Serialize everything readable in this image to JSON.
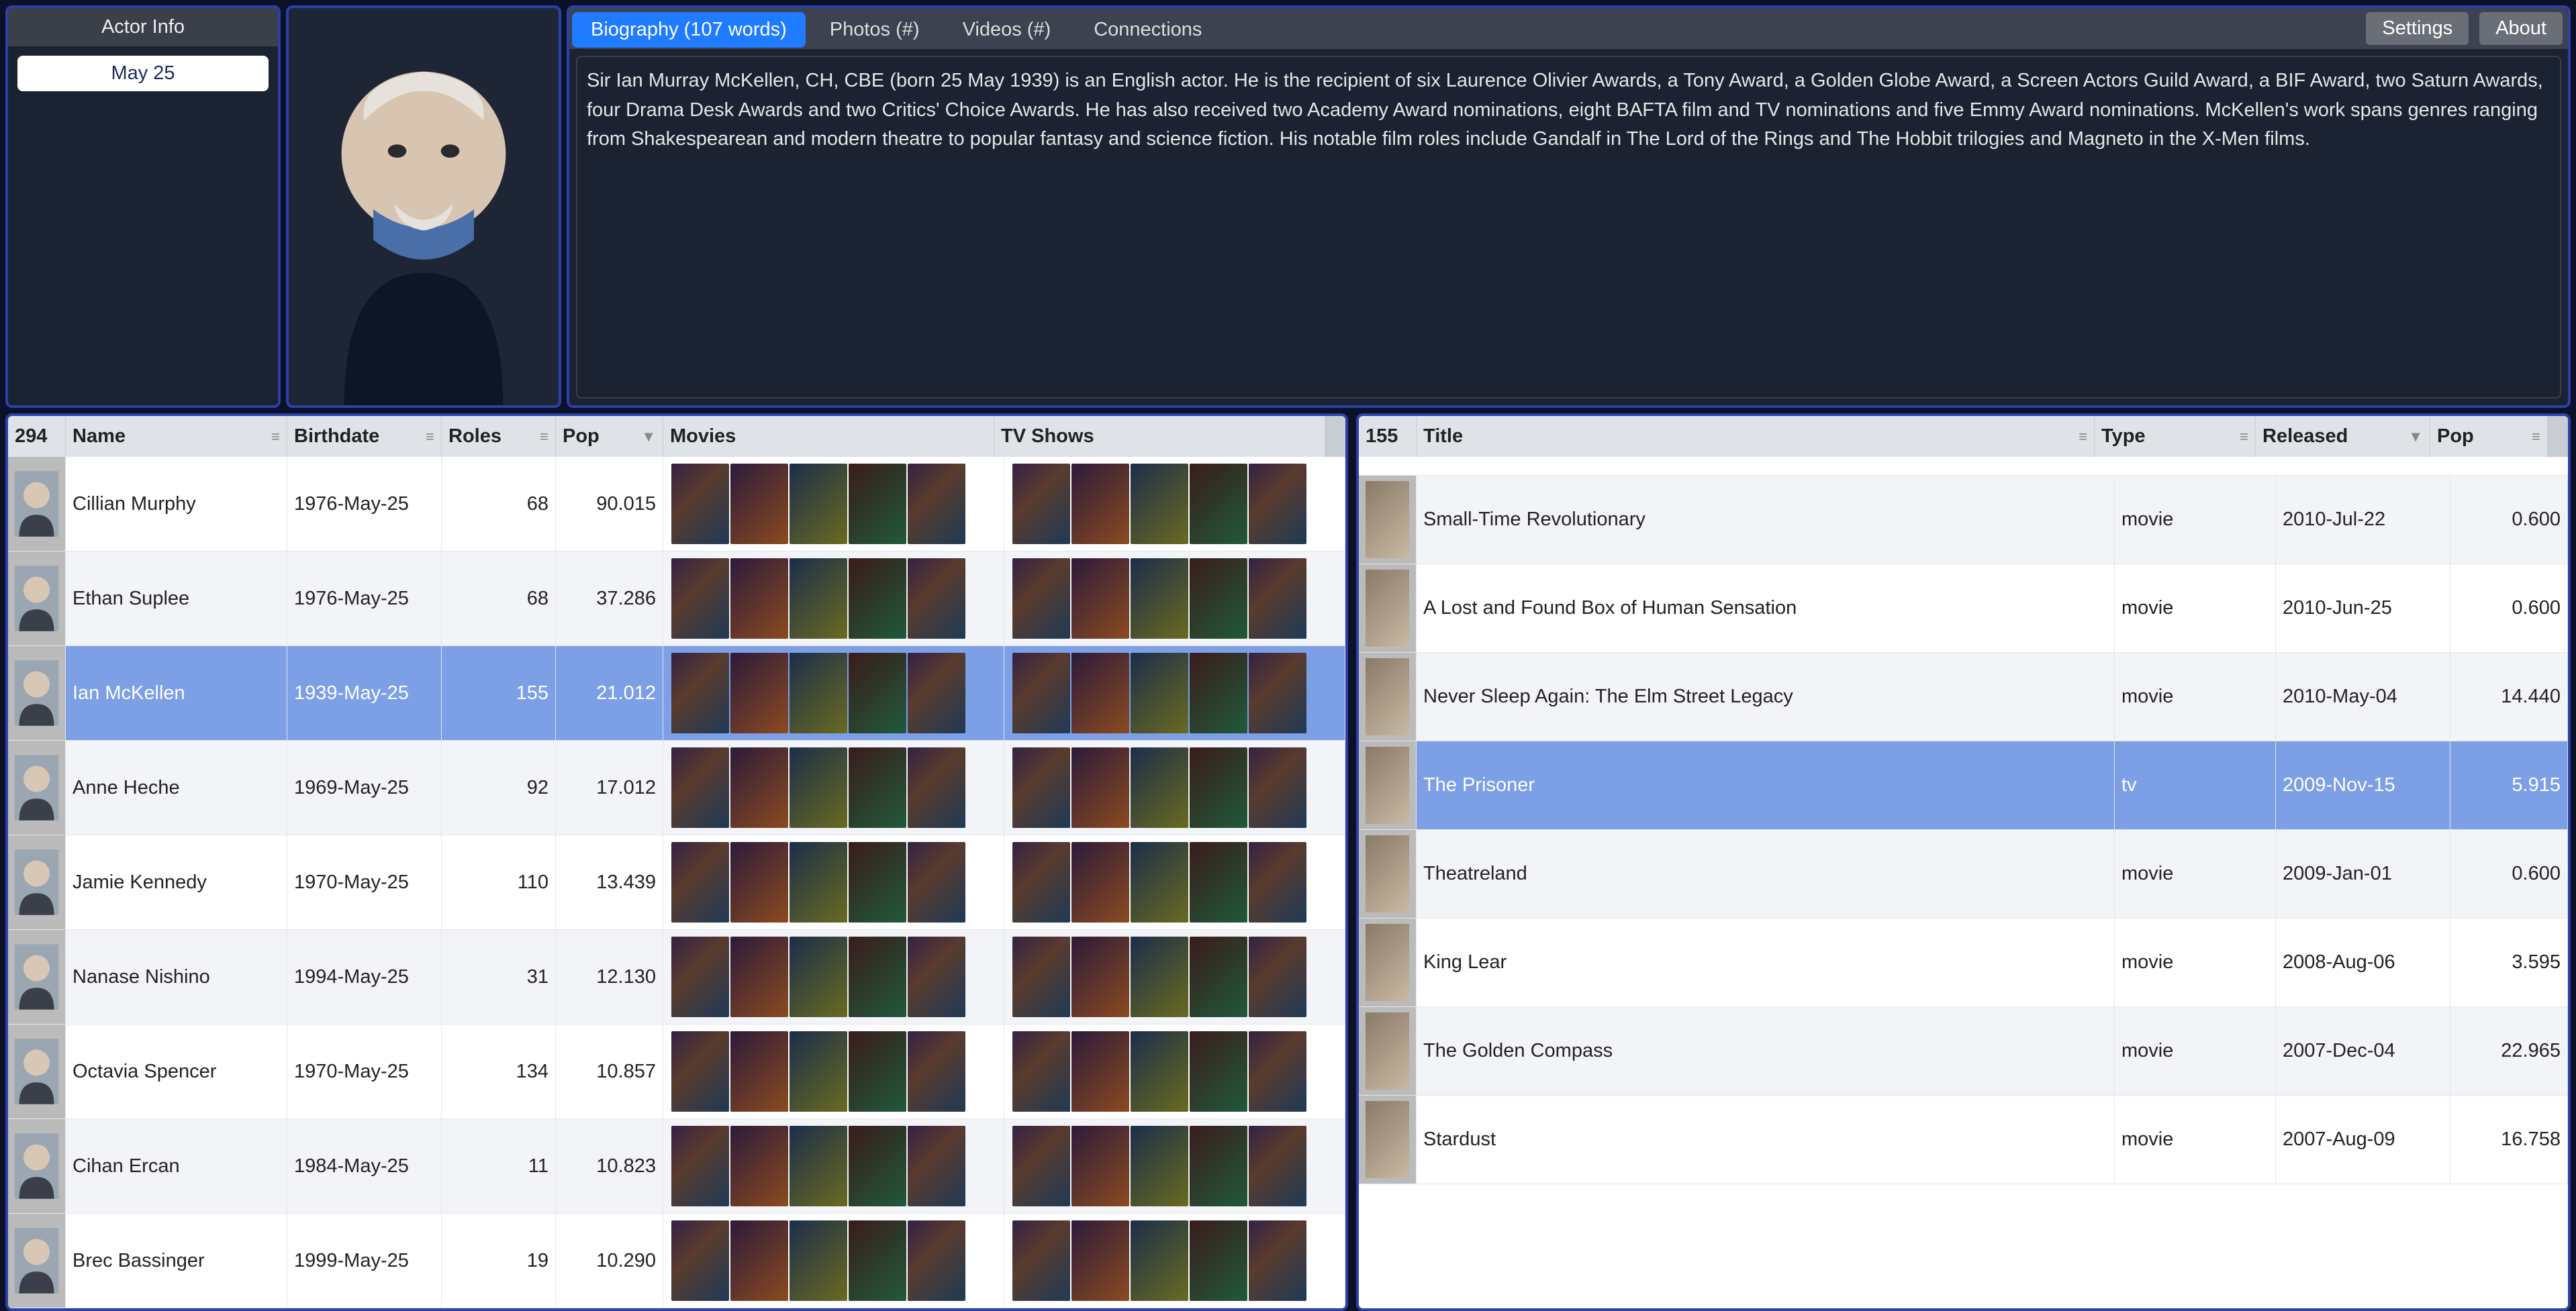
{
  "info": {
    "heading": "Actor Info",
    "chip": "May 25"
  },
  "tabs": {
    "items": [
      {
        "label": "Biography (107 words)",
        "active": true
      },
      {
        "label": "Photos (#)"
      },
      {
        "label": "Videos (#)"
      },
      {
        "label": "Connections"
      }
    ],
    "settings": "Settings",
    "about": "About"
  },
  "biography": "Sir Ian Murray McKellen, CH, CBE (born 25 May 1939) is an English actor. He is the recipient of six Laurence Olivier Awards, a Tony Award, a Golden Globe Award, a Screen Actors Guild Award, a BIF Award, two Saturn Awards, four Drama Desk Awards and two Critics' Choice Awards. He has also received two Academy Award nominations, eight BAFTA film and TV nominations and five Emmy Award nominations. McKellen's work spans genres ranging from Shakespearean and modern theatre to popular fantasy and science fiction. His notable film roles include Gandalf in The Lord of the Rings and The Hobbit trilogies and Magneto in the X-Men films.",
  "actors_table": {
    "count": "294",
    "columns": [
      "Name",
      "Birthdate",
      "Roles",
      "Pop",
      "Movies",
      "TV Shows"
    ],
    "sort_on": "Pop",
    "rows": [
      {
        "name": "Cillian Murphy",
        "birthdate": "1976-May-25",
        "roles": "68",
        "pop": "90.015"
      },
      {
        "name": "Ethan Suplee",
        "birthdate": "1976-May-25",
        "roles": "68",
        "pop": "37.286"
      },
      {
        "name": "Ian McKellen",
        "birthdate": "1939-May-25",
        "roles": "155",
        "pop": "21.012",
        "selected": true
      },
      {
        "name": "Anne Heche",
        "birthdate": "1969-May-25",
        "roles": "92",
        "pop": "17.012"
      },
      {
        "name": "Jamie Kennedy",
        "birthdate": "1970-May-25",
        "roles": "110",
        "pop": "13.439"
      },
      {
        "name": "Nanase Nishino",
        "birthdate": "1994-May-25",
        "roles": "31",
        "pop": "12.130"
      },
      {
        "name": "Octavia Spencer",
        "birthdate": "1970-May-25",
        "roles": "134",
        "pop": "10.857"
      },
      {
        "name": "Cihan Ercan",
        "birthdate": "1984-May-25",
        "roles": "11",
        "pop": "10.823"
      },
      {
        "name": "Brec Bassinger",
        "birthdate": "1999-May-25",
        "roles": "19",
        "pop": "10.290"
      }
    ]
  },
  "titles_table": {
    "count": "155",
    "columns": [
      "Title",
      "Type",
      "Released",
      "Pop"
    ],
    "sort_on": "Released",
    "rows": [
      {
        "title": "Small-Time Revolutionary",
        "type": "movie",
        "released": "2010-Jul-22",
        "pop": "0.600"
      },
      {
        "title": "A Lost and Found Box of Human Sensation",
        "type": "movie",
        "released": "2010-Jun-25",
        "pop": "0.600"
      },
      {
        "title": "Never Sleep Again: The Elm Street Legacy",
        "type": "movie",
        "released": "2010-May-04",
        "pop": "14.440"
      },
      {
        "title": "The Prisoner",
        "type": "tv",
        "released": "2009-Nov-15",
        "pop": "5.915",
        "selected": true
      },
      {
        "title": "Theatreland",
        "type": "movie",
        "released": "2009-Jan-01",
        "pop": "0.600"
      },
      {
        "title": "King Lear",
        "type": "movie",
        "released": "2008-Aug-06",
        "pop": "3.595"
      },
      {
        "title": "The Golden Compass",
        "type": "movie",
        "released": "2007-Dec-04",
        "pop": "22.965"
      },
      {
        "title": "Stardust",
        "type": "movie",
        "released": "2007-Aug-09",
        "pop": "16.758"
      }
    ]
  },
  "icons": {
    "sort_both": "≡",
    "sort_desc": "▼"
  }
}
